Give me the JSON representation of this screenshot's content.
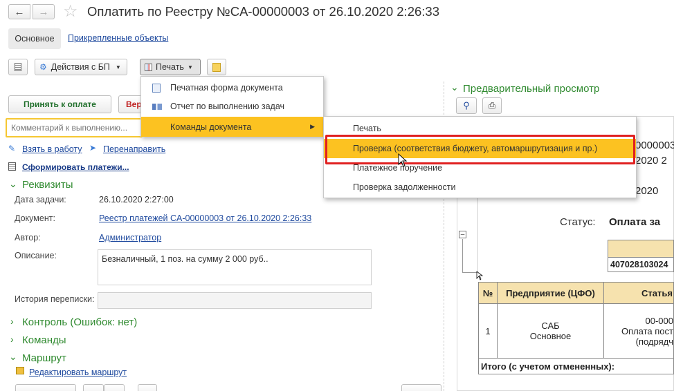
{
  "window": {
    "title": "Оплатить по Реестру №CA-00000003 от 26.10.2020 2:26:33"
  },
  "tabs": [
    {
      "label": "Основное"
    },
    {
      "label": "Прикрепленные объекты"
    }
  ],
  "toolbar": {
    "actions_label": "Действия с БП",
    "print_label": "Печать"
  },
  "print_menu": {
    "items": [
      {
        "label": "Печатная форма документа",
        "icon": "document-icon"
      },
      {
        "label": "Отчет по выполнению задач",
        "icon": "report-icon"
      },
      {
        "label": "Команды документа",
        "icon": "submenu-arrow"
      }
    ]
  },
  "submenu": {
    "items": [
      {
        "label": "Печать"
      },
      {
        "label": "Проверка (соответствия бюджету, автомаршрутизация и пр.)"
      },
      {
        "label": "Платежное поручение"
      },
      {
        "label": "Проверка задолженности"
      }
    ]
  },
  "task_buttons": {
    "accept": "Принять к оплате",
    "return": "Вер"
  },
  "comment": {
    "placeholder": "Комментарий к выполнению..."
  },
  "links": {
    "take_to_work": "Взять в работу",
    "redirect": "Перенаправить",
    "form_payments": "Сформировать платежи..."
  },
  "sections": {
    "requisites": "Реквизиты",
    "control": "Контроль (Ошибок: нет)",
    "commands": "Команды",
    "route": "Маршрут",
    "edit_route": "Редактировать маршрут"
  },
  "fields": {
    "task_date_label": "Дата задачи:",
    "task_date_value": "26.10.2020 2:27:00",
    "document_label": "Документ:",
    "document_value": "Реестр платежей CA-00000003 от 26.10.2020 2:26:33",
    "author_label": "Автор:",
    "author_value": "Администратор",
    "description_label": "Описание:",
    "description_value": "Безналичный, 1 поз. на сумму 2 000 руб..",
    "history_label": "История переписки:"
  },
  "preview": {
    "title": "Предварительный просмотр",
    "doc_number_fragment": "0000003",
    "date_fragment1": "2020 2",
    "date_fragment2": "2020",
    "status_label": "Статус:",
    "status_value": "Оплата за",
    "account_fragment": "407028103024",
    "table": {
      "headers": [
        "№",
        "Предприятие (ЦФО)",
        "Статья"
      ],
      "row": {
        "num": "1",
        "org_line1": "САБ",
        "org_line2": "Основное",
        "art_line1": "00-000",
        "art_line2": "Оплата пост",
        "art_line3": "(подрядч"
      },
      "total": "Итого (с учетом отмененных):"
    }
  },
  "colors": {
    "menu_highlight": "#fcc221",
    "selection_border": "#e02020",
    "section_green": "#2f8a2f",
    "link_blue": "#1f4a9e",
    "table_header": "#f6e2ae"
  }
}
